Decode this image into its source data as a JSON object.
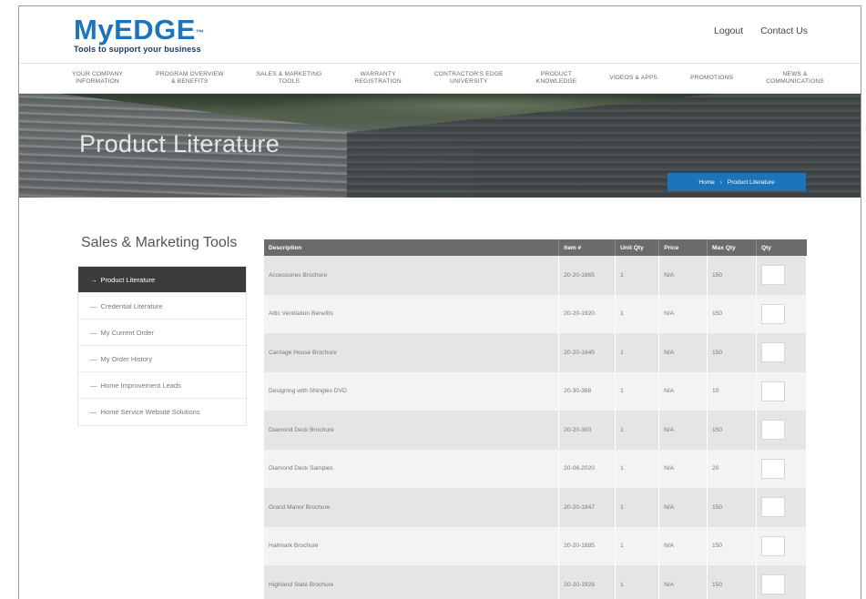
{
  "header": {
    "logo_text": "MyEDGE",
    "logo_tm": "™",
    "tagline": "Tools to support your business",
    "links": [
      "Logout",
      "Contact Us"
    ]
  },
  "nav": [
    "YOUR COMPANY\nINFORMATION",
    "PROGRAM OVERVIEW\n& BENEFITS",
    "SALES & MARKETING\nTOOLS",
    "WARRANTY\nREGISTRATION",
    "CONTRACTOR'S EDGE\nUNIVERSITY",
    "PRODUCT\nKNOWLEDGE",
    "VIDEOS & APPS",
    "PROMOTIONS",
    "NEWS &\nCOMMUNICATIONS"
  ],
  "hero": {
    "title": "Product Literature",
    "breadcrumb_home": "Home",
    "breadcrumb_sep": "›",
    "breadcrumb_current": "Product Literature"
  },
  "sidebar": {
    "title": "Sales & Marketing Tools",
    "items": [
      {
        "prefix": "→",
        "label": "Product Literature"
      },
      {
        "prefix": "—",
        "label": "Credential Literature"
      },
      {
        "prefix": "—",
        "label": "My Current Order"
      },
      {
        "prefix": "—",
        "label": "My Order History"
      },
      {
        "prefix": "—",
        "label": "Home Improvement Leads"
      },
      {
        "prefix": "—",
        "label": "Home Service Website Solutions"
      }
    ]
  },
  "table": {
    "headers": [
      "Description",
      "Item #",
      "Unit Qty",
      "Price",
      "Max Qty",
      "Qty"
    ],
    "rows": [
      {
        "desc": "Accessories Brochure",
        "item": "20-20-1865",
        "unit": "1",
        "price": "N/A",
        "max": "150"
      },
      {
        "desc": "Attic Ventilation Benefits",
        "item": "20-20-1920",
        "unit": "1",
        "price": "N/A",
        "max": "150"
      },
      {
        "desc": "Carriage House Brochure",
        "item": "20-20-1845",
        "unit": "1",
        "price": "N/A",
        "max": "150"
      },
      {
        "desc": "Designing with Shingles DVD",
        "item": "20-30-368",
        "unit": "1",
        "price": "N/A",
        "max": "10"
      },
      {
        "desc": "Diamond Deck Brochure",
        "item": "20-20-300",
        "unit": "1",
        "price": "N/A",
        "max": "150"
      },
      {
        "desc": "Diamond Deck Samples",
        "item": "20-06-2020",
        "unit": "1",
        "price": "N/A",
        "max": "20"
      },
      {
        "desc": "Grand Manor Brochure",
        "item": "20-20-1847",
        "unit": "1",
        "price": "N/A",
        "max": "150"
      },
      {
        "desc": "Hallmark Brochure",
        "item": "20-20-1885",
        "unit": "1",
        "price": "N/A",
        "max": "150"
      },
      {
        "desc": "Highland Slate Brochure",
        "item": "20-20-1928",
        "unit": "1",
        "price": "N/A",
        "max": "150"
      }
    ]
  }
}
